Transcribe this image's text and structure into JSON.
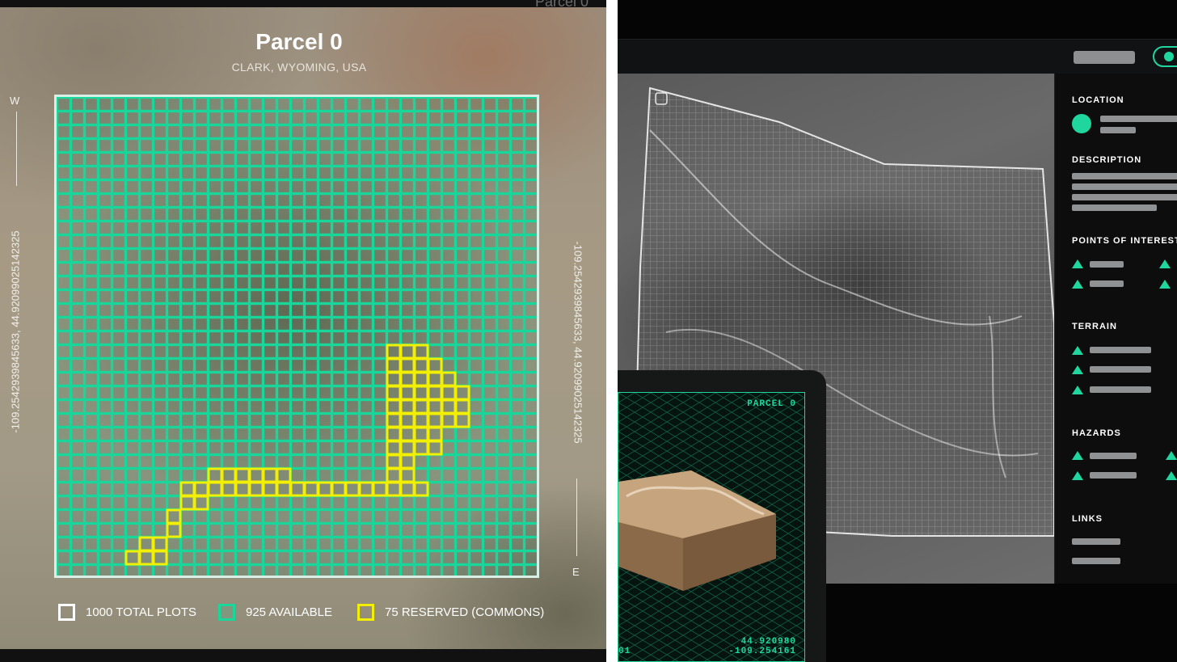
{
  "left_panel": {
    "ghost_title": "Parcel 0",
    "title": "Parcel 0",
    "subtitle": "CLARK, WYOMING, USA",
    "compass_west": "W",
    "compass_east": "E",
    "coordinates": "-109.2542939845633, 44.92099025142325",
    "legend": [
      {
        "label": "1000 TOTAL PLOTS",
        "color": "#ffffff"
      },
      {
        "label": "925 AVAILABLE",
        "color": "#19d69a"
      },
      {
        "label": "75 RESERVED (COMMONS)",
        "color": "#f2ef00"
      }
    ],
    "grid": {
      "total_plots": 1000,
      "available": 925,
      "reserved": 75,
      "available_color": "#19d69a",
      "reserved_color": "#f2ef00",
      "border_color": "#d8efe6"
    }
  },
  "right_panel": {
    "sidebar": {
      "location": "LOCATION",
      "description": "DESCRIPTION",
      "points_of_interest": "POINTS OF INTEREST",
      "terrain": "TERRAIN",
      "hazards": "HAZARDS",
      "links": "LINKS"
    },
    "inset": {
      "label": "PARCEL 0",
      "lat": "44.920980",
      "lon": "-109.254161",
      "left_fragment": "01"
    },
    "accent_color": "#1fd79e"
  }
}
